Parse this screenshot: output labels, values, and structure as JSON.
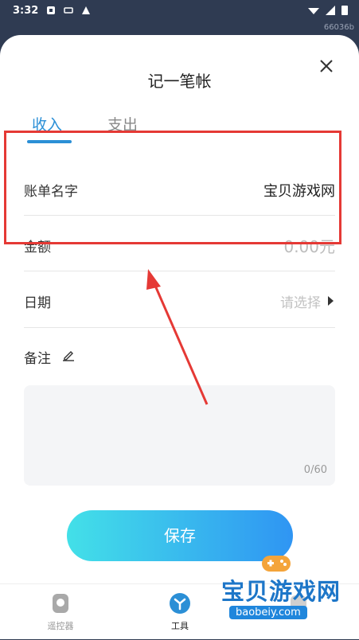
{
  "status_bar": {
    "time": "3:32",
    "build_tag": "66036b"
  },
  "dialog": {
    "title": "记一笔帐",
    "tabs": [
      {
        "label": "收入",
        "active": true
      },
      {
        "label": "支出",
        "active": false
      }
    ],
    "fields": {
      "name": {
        "label": "账单名字",
        "value": "宝贝游戏网"
      },
      "amount": {
        "label": "金额",
        "placeholder": "0.00元"
      },
      "date": {
        "label": "日期",
        "placeholder": "请选择"
      },
      "note": {
        "label": "备注",
        "counter": "0/60"
      }
    },
    "save_label": "保存"
  },
  "bottom_nav": {
    "items": [
      {
        "label": "遥控器",
        "icon": "remote-icon"
      },
      {
        "label": "工具",
        "icon": "tools-icon",
        "active": true
      },
      {
        "label": "",
        "icon": "third-icon"
      }
    ]
  },
  "watermark": {
    "name": "宝贝游戏网",
    "url": "baobeiy.com"
  },
  "colors": {
    "accent": "#2b8fd6",
    "highlight": "#e53935",
    "button_start": "#43e0e8",
    "button_end": "#2f95f3"
  }
}
